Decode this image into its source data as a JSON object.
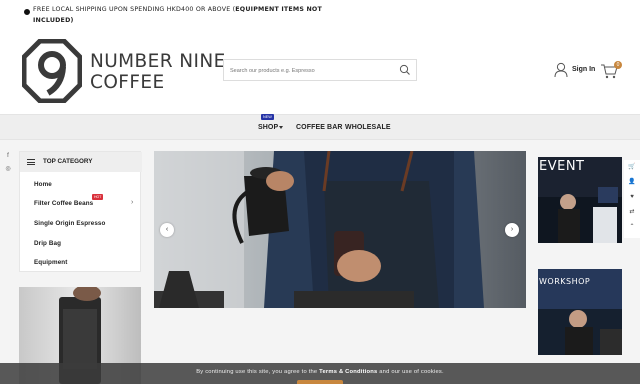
{
  "announcement": {
    "text_plain": "FREE LOCAL SHIPPING UPON SPENDING HKD400 OR ABOVE (",
    "text_bold": "EQUIPMENT ITEMS NOT INCLUDED",
    "text_close": ")"
  },
  "brand": {
    "line1": "NUMBER NINE",
    "line2": "COFFEE"
  },
  "search": {
    "placeholder": "Search our products e.g. Espresso"
  },
  "account": {
    "signin_label": "Sign In"
  },
  "cart": {
    "count": "0"
  },
  "nav": {
    "items": [
      {
        "label": "SHOP",
        "badge": "NEW"
      },
      {
        "label": "COFFEE BAR"
      },
      {
        "label": "WHOLESALE"
      }
    ]
  },
  "social": {
    "icons": [
      "facebook-icon",
      "instagram-icon"
    ],
    "glyphs": [
      "f",
      "◎"
    ]
  },
  "category": {
    "title": "TOP CATEGORY",
    "items": [
      {
        "label": "Home"
      },
      {
        "label": "Filter Coffee Beans",
        "badge": "HOT"
      },
      {
        "label": "Single Origin Espresso"
      },
      {
        "label": "Drip Bag"
      },
      {
        "label": "Equipment"
      }
    ]
  },
  "promos": [
    {
      "label": "EVENT"
    },
    {
      "label": "WORKSHOP"
    }
  ],
  "right_rail": {
    "icons": [
      "cart-icon",
      "user-icon",
      "heart-icon",
      "shuffle-icon",
      "arrow-up-icon"
    ],
    "glyphs": [
      "🛒",
      "👤",
      "♥",
      "⇄",
      "⌃"
    ]
  },
  "cookie": {
    "before": "By continuing use this site, you agree to the ",
    "link": "Terms & Conditions",
    "after": " and our use of cookies."
  },
  "colors": {
    "accent": "#c8873e",
    "new_badge": "#2533a6",
    "hot_badge": "#d9303b"
  }
}
